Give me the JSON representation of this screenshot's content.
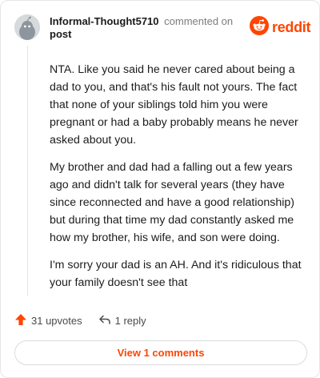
{
  "comment": {
    "author": "Informal-Thought5710",
    "action": "commented on",
    "target": "post",
    "paragraphs": [
      "NTA. Like you said he never cared about being a dad to you, and that's his fault not yours. The fact that none of your siblings told him you were pregnant or had a baby probably means he never asked about you.",
      "My brother and dad had a falling out a few years ago and didn't talk for several years (they have since reconnected and have a good relationship) but during that time my dad constantly asked me how my brother, his wife, and son were doing.",
      "I'm sorry your dad is an AH. And it's ridiculous that your family doesn't see that"
    ],
    "upvotes_label": "31 upvotes",
    "replies_label": "1 reply",
    "view_comments_label": "View 1 comments"
  },
  "brand": {
    "name": "reddit",
    "icon": "reddit-logo-icon",
    "color": "#ff4500"
  },
  "icons": {
    "avatar": "default-avatar-icon",
    "upvote": "upvote-arrow-icon",
    "reply": "reply-arrow-icon"
  },
  "colors": {
    "accent": "#ff4500",
    "muted_text": "#7c7c7c",
    "body_text": "#1c1c1c"
  }
}
